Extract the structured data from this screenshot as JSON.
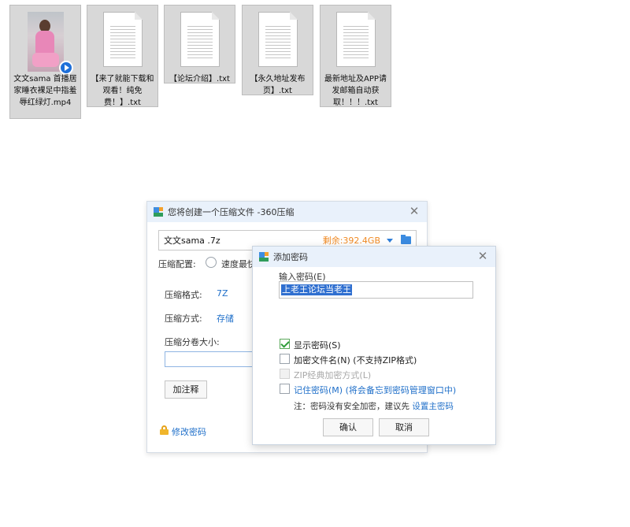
{
  "files": [
    {
      "name": "文文sama 首播居家睡衣裸足中指羞辱红绿灯.mp4",
      "kind": "video"
    },
    {
      "name": "【来了就能下载和观看！纯免费！】.txt",
      "kind": "text"
    },
    {
      "name": "【论坛介绍】.txt",
      "kind": "text"
    },
    {
      "name": "【永久地址发布页】.txt",
      "kind": "text"
    },
    {
      "name": "最新地址及APP请发邮箱自动获取！！！.txt",
      "kind": "text"
    }
  ],
  "main_dialog": {
    "title": "您将创建一个压缩文件 -360压缩",
    "close_symbol": "✕",
    "filename": "文文sama .7z",
    "free_space": "剩余:392.4GB",
    "config_label": "压缩配置:",
    "speed_option": "速度最快",
    "format_label": "压缩格式:",
    "format_value": "7Z",
    "method_label": "压缩方式:",
    "method_value": "存储",
    "split_label": "压缩分卷大小:",
    "comment_button": "加注释",
    "change_password_link": "修改密码"
  },
  "password_dialog": {
    "title": "添加密码",
    "close_symbol": "✕",
    "input_label": "输入密码(E)",
    "password_value": "上老王论坛当老王",
    "options": [
      {
        "label": "显示密码(S)",
        "checked": true,
        "disabled": false
      },
      {
        "label": "加密文件名(N) (不支持ZIP格式)",
        "checked": false,
        "disabled": false
      },
      {
        "label": "ZIP经典加密方式(L)",
        "checked": false,
        "disabled": true
      },
      {
        "label": "记住密码(M) (将会备忘到密码管理窗口中)",
        "checked": false,
        "disabled": false
      }
    ],
    "note_prefix": "注：密码没有安全加密，建议先",
    "note_link": "设置主密码",
    "ok_button": "确认",
    "cancel_button": "取消"
  }
}
